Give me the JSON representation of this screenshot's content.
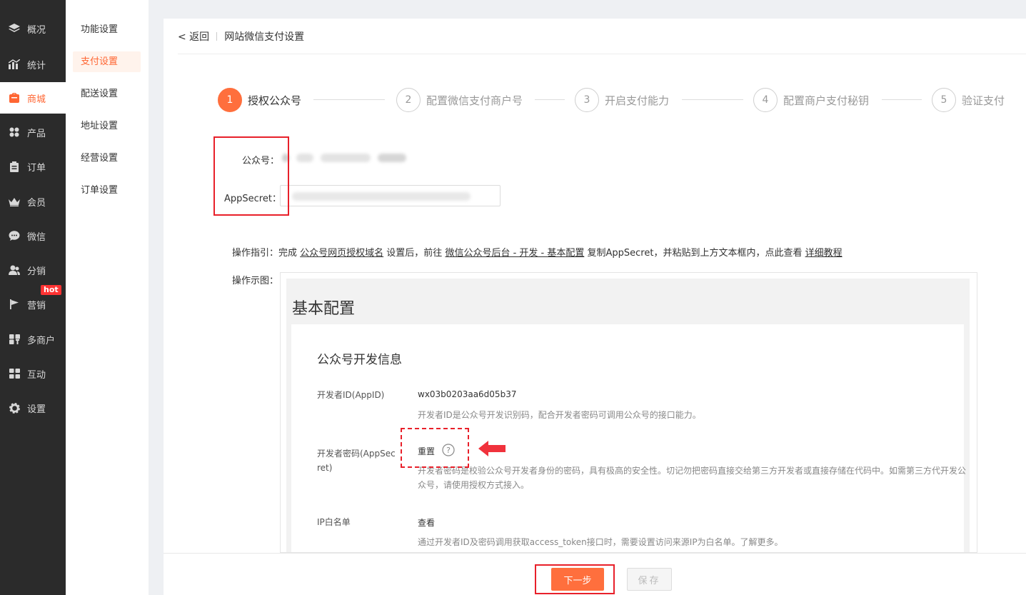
{
  "nav_primary": [
    {
      "label": "概况",
      "icon": "layers-icon"
    },
    {
      "label": "统计",
      "icon": "chart-icon"
    },
    {
      "label": "商城",
      "icon": "shop-icon",
      "active": true
    },
    {
      "label": "产品",
      "icon": "grid-icon"
    },
    {
      "label": "订单",
      "icon": "clipboard-icon"
    },
    {
      "label": "会员",
      "icon": "crown-icon"
    },
    {
      "label": "微信",
      "icon": "wechat-icon"
    },
    {
      "label": "分销",
      "icon": "users-icon"
    },
    {
      "label": "营销",
      "icon": "flag-icon",
      "badge": "hot"
    },
    {
      "label": "多商户",
      "icon": "store-icon"
    },
    {
      "label": "互动",
      "icon": "apps-icon"
    },
    {
      "label": "设置",
      "icon": "gear-icon"
    }
  ],
  "nav_secondary": [
    {
      "label": "功能设置"
    },
    {
      "label": "支付设置",
      "active": true
    },
    {
      "label": "配送设置"
    },
    {
      "label": "地址设置"
    },
    {
      "label": "经营设置"
    },
    {
      "label": "订单设置"
    }
  ],
  "topbar": {
    "back": "< 返回",
    "title": "网站微信支付设置"
  },
  "steps": [
    {
      "num": "1",
      "label": "授权公众号",
      "active": true
    },
    {
      "num": "2",
      "label": "配置微信支付商户号"
    },
    {
      "num": "3",
      "label": "开启支付能力"
    },
    {
      "num": "4",
      "label": "配置商户支付秘钥"
    },
    {
      "num": "5",
      "label": "验证支付"
    }
  ],
  "form": {
    "account_label": "公众号：",
    "secret_label": "AppSecret："
  },
  "guide": {
    "label": "操作指引：",
    "t1": "完成 ",
    "link1": "公众号网页授权域名",
    "t2": " 设置后，前往 ",
    "link2": "微信公众号后台 - 开发 - 基本配置",
    "t3": " 复制AppSecret，并粘贴到上方文本框内，点此查看 ",
    "link3": "详细教程"
  },
  "example": {
    "label": "操作示图：",
    "title": "基本配置",
    "card_title": "公众号开发信息",
    "appid_label": "开发者ID(AppID)",
    "appid_value": "wx03b0203aa6d05b37",
    "appid_desc": "开发者ID是公众号开发识别码，配合开发者密码可调用公众号的接口能力。",
    "secret_label_l1": "开发者密码(AppSec",
    "secret_label_l2": "ret)",
    "secret_value": "重置",
    "secret_desc": "开发者密码是校验公众号开发者身份的密码，具有极高的安全性。切记勿把密码直接交给第三方开发者或直接存储在代码中。如需第三方代开发公众号，请使用授权方式接入。",
    "ip_label": "IP白名单",
    "ip_value": "查看",
    "ip_desc": "通过开发者ID及密码调用获取access_token接口时，需要设置访问来源IP为白名单。了解更多。"
  },
  "footer": {
    "next": "下一步",
    "save": "保存"
  },
  "colors": {
    "accent": "#ff6f3d",
    "highlight": "#e8202a",
    "nav_bg": "#2b2b2b"
  }
}
